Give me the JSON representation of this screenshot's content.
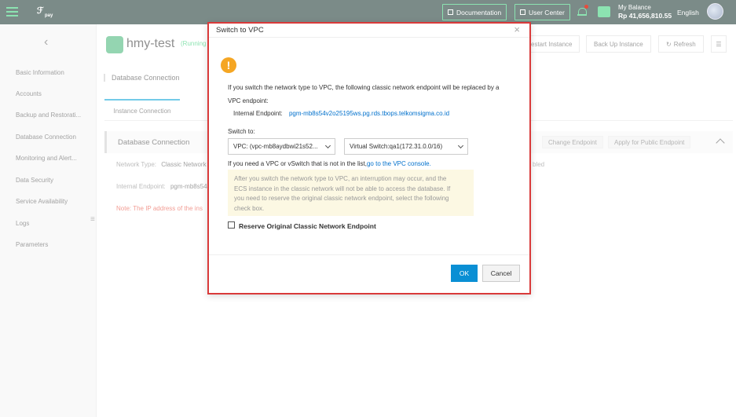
{
  "topbar": {
    "documentation": "Documentation",
    "user_center": "User Center",
    "balance_label": "My Balance",
    "balance_value": "Rp 41,656,810.55",
    "language": "English",
    "accent": "#2ecc71",
    "bg": "#0f2d27"
  },
  "sidebar": {
    "items": [
      "Basic Information",
      "Accounts",
      "Backup and Restorati...",
      "Database Connection",
      "Monitoring and Alert...",
      "Data Security",
      "Service Availability",
      "Logs",
      "Parameters"
    ]
  },
  "instance": {
    "name": "hmy-test",
    "status": "(Running",
    "buttons": {
      "restart": "estart Instance",
      "backup": "Back Up Instance",
      "refresh": "Refresh"
    }
  },
  "page": {
    "section_title": "Database Connection",
    "tab": "Instance Connection",
    "panel_title": "Database Connection",
    "change_endpoint": "Change Endpoint",
    "public_endpoint": "Apply for Public Endpoint",
    "network_type_label": "Network Type:",
    "network_type_value": "Classic Network",
    "network_suffix": "bled",
    "internal_label": "Internal Endpoint:",
    "internal_value": "pgm-mb8s54",
    "note": "Note: The IP address of the ins"
  },
  "modal": {
    "title": "Switch to VPC",
    "line1": "If you switch the network type to VPC, the following classic network endpoint will be replaced by a",
    "line2": "VPC endpoint:",
    "endpoint_label": "Internal Endpoint:",
    "endpoint_value": "pgm-mb8s54v2o25195ws.pg.rds.tbops.telkomsigma.co.id",
    "switch_to": "Switch to:",
    "vpc_select": "VPC: (vpc-mb8aydbwi21s52...",
    "vswitch_select": "Virtual Switch:qa1(172.31.0.0/16)",
    "need_vpc": "If you need a VPC or vSwitch that is not in the list,",
    "vpc_console": "go to the VPC console.",
    "warn_line1": "After you switch the network type to VPC, an interruption may occur, and the",
    "warn_line2": "ECS instance in the classic network will not be able to access the database. If",
    "warn_line3": "you need to reserve the original classic network endpoint, select the following",
    "warn_line4": "check box.",
    "reserve_label": "Reserve Original Classic Network Endpoint",
    "ok": "OK",
    "cancel": "Cancel",
    "border_color": "#d93a3a"
  }
}
